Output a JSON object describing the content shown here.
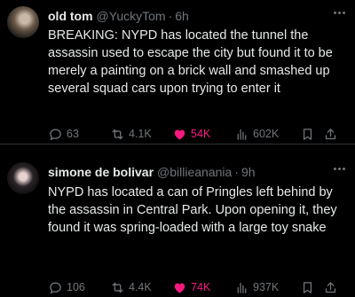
{
  "tweets": [
    {
      "display_name": "old tom",
      "handle": "@YuckyTom",
      "separator": "·",
      "time": "6h",
      "text": "BREAKING: NYPD has located the tunnel the assassin used to escape the city but found it to be merely a painting on a brick wall and smashed up several squad cars upon trying to enter it",
      "replies": "63",
      "reposts": "4.1K",
      "likes": "54K",
      "views": "602K",
      "liked": true
    },
    {
      "display_name": "simone de bolivar",
      "handle": "@billieanania",
      "separator": "·",
      "time": "9h",
      "text": "NYPD has located a can of Pringles left behind by the assassin in Central Park. Upon opening it, they found it was spring-loaded with a large toy snake",
      "replies": "106",
      "reposts": "4.4K",
      "likes": "74K",
      "views": "937K",
      "liked": true
    }
  ],
  "colors": {
    "background": "#000000",
    "text": "#e7e9ea",
    "muted": "#71767b",
    "like_active": "#f91880",
    "divider": "#2f3336"
  },
  "icons": [
    "reply-icon",
    "repost-icon",
    "like-icon",
    "views-icon",
    "bookmark-icon",
    "share-icon",
    "more-icon"
  ]
}
